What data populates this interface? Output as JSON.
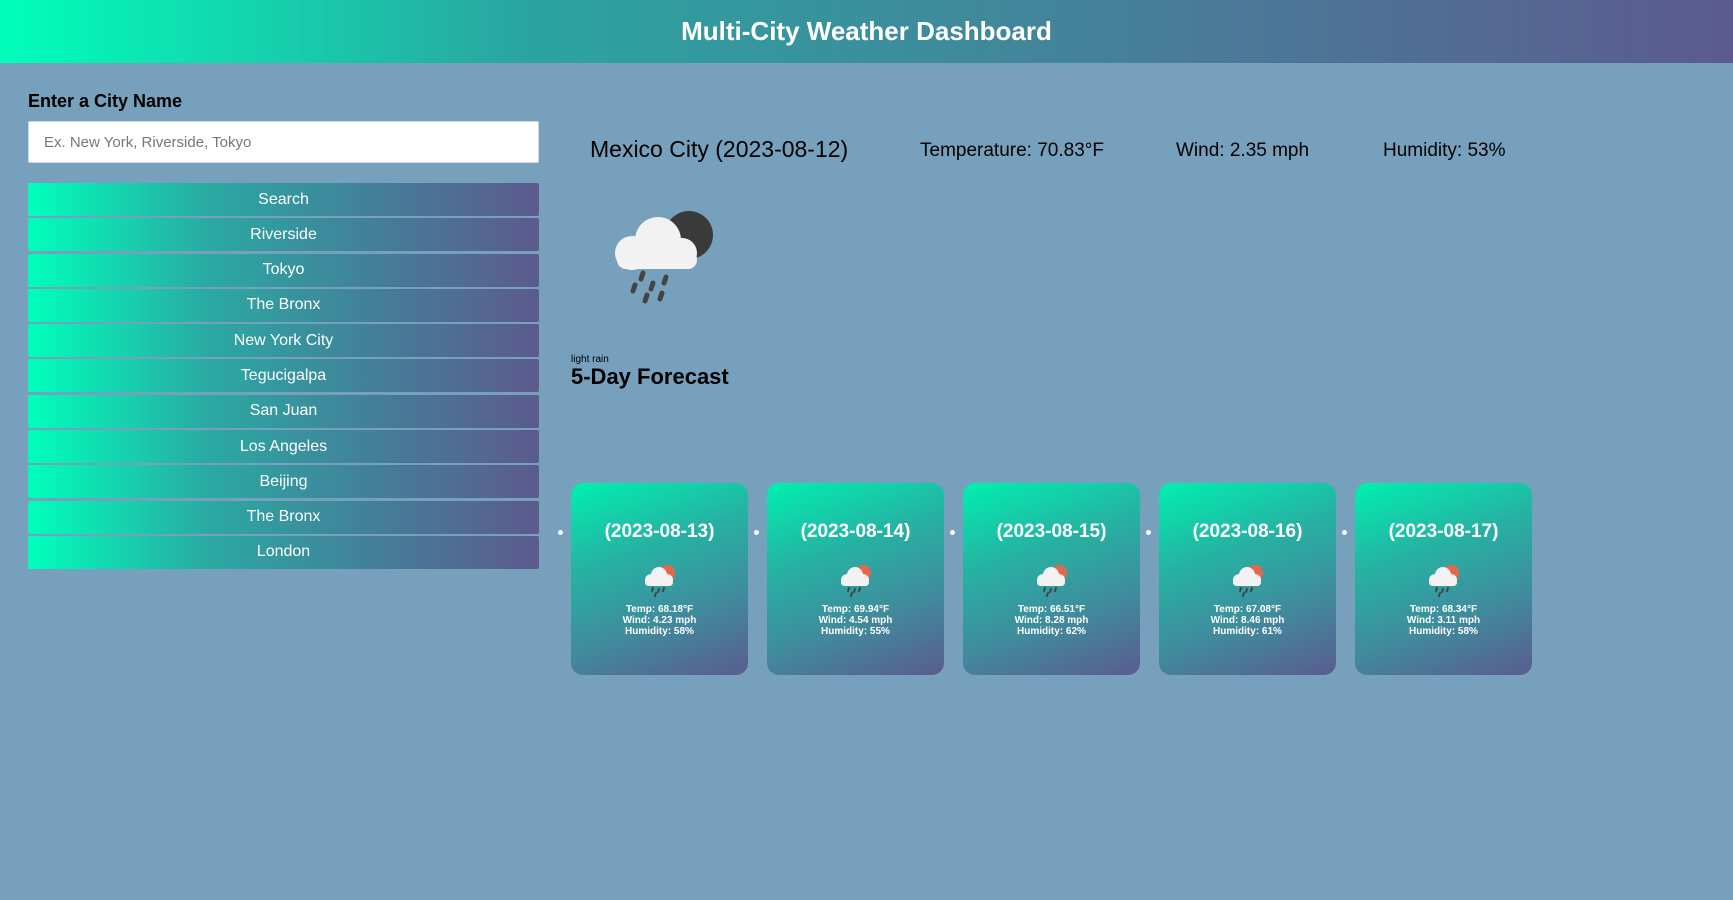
{
  "header": {
    "title": "Multi-City Weather Dashboard"
  },
  "search": {
    "label": "Enter a City Name",
    "placeholder": "Ex. New York, Riverside, Tokyo",
    "button_label": "Search"
  },
  "history": [
    "Riverside",
    "Tokyo",
    "The Bronx",
    "New York City",
    "Tegucigalpa",
    "San Juan",
    "Los Angeles",
    "Beijing",
    "The Bronx",
    "London"
  ],
  "current": {
    "city_date": "Mexico City (2023-08-12)",
    "temperature": "Temperature: 70.83°F",
    "wind": "Wind: 2.35 mph",
    "humidity": "Humidity: 53%",
    "description": "light rain",
    "icon": "rain-night-icon"
  },
  "forecast": {
    "title": "5-Day Forecast",
    "days": [
      {
        "date": "(2023-08-13)",
        "temp": "Temp: 68.18°F",
        "wind": "Wind: 4.23 mph",
        "humidity": "Humidity: 58%",
        "icon": "rain-day-icon"
      },
      {
        "date": "(2023-08-14)",
        "temp": "Temp: 69.94°F",
        "wind": "Wind: 4.54 mph",
        "humidity": "Humidity: 55%",
        "icon": "rain-day-icon"
      },
      {
        "date": "(2023-08-15)",
        "temp": "Temp: 66.51°F",
        "wind": "Wind: 8.28 mph",
        "humidity": "Humidity: 62%",
        "icon": "rain-day-icon"
      },
      {
        "date": "(2023-08-16)",
        "temp": "Temp: 67.08°F",
        "wind": "Wind: 8.46 mph",
        "humidity": "Humidity: 61%",
        "icon": "rain-day-icon"
      },
      {
        "date": "(2023-08-17)",
        "temp": "Temp: 68.34°F",
        "wind": "Wind: 3.11 mph",
        "humidity": "Humidity: 58%",
        "icon": "rain-day-icon"
      }
    ]
  },
  "colors": {
    "background": "#77a0bc",
    "accent_start": "#00ffbb",
    "accent_end": "#5c5a90"
  }
}
